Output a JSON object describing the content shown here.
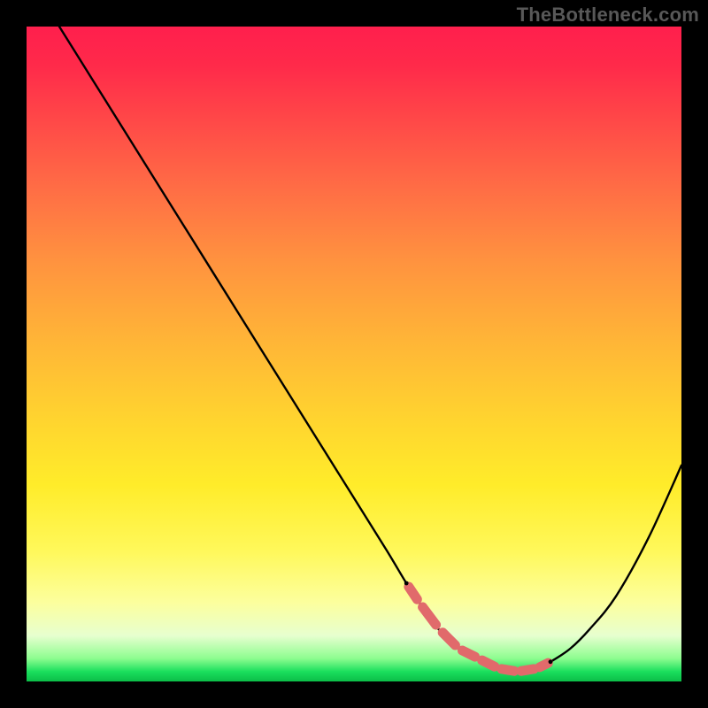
{
  "watermark": "TheBottleneck.com",
  "colors": {
    "curve_stroke": "#000000",
    "dash_stroke": "#e16a6b",
    "gradient_top": "#ff1f4d",
    "gradient_bottom": "#0bbd48"
  },
  "chart_data": {
    "type": "line",
    "title": "",
    "xlabel": "",
    "ylabel": "",
    "xlim": [
      0,
      100
    ],
    "ylim": [
      0,
      100
    ],
    "x": [
      5,
      10,
      15,
      20,
      25,
      30,
      35,
      40,
      45,
      50,
      55,
      58,
      60,
      62,
      65,
      68,
      70,
      72,
      75,
      78,
      80,
      83,
      86,
      90,
      95,
      100
    ],
    "y": [
      100,
      92,
      84,
      76,
      68,
      60,
      52,
      44,
      36,
      28,
      20,
      15,
      12,
      9,
      6,
      4,
      3,
      2,
      1.5,
      2,
      3,
      5,
      8,
      13,
      22,
      33
    ],
    "optimal_region": {
      "x": [
        58,
        60,
        63,
        66,
        69,
        72,
        75,
        78,
        80
      ],
      "y": [
        15,
        12,
        8,
        5,
        3.5,
        2,
        1.5,
        2,
        3
      ]
    }
  }
}
